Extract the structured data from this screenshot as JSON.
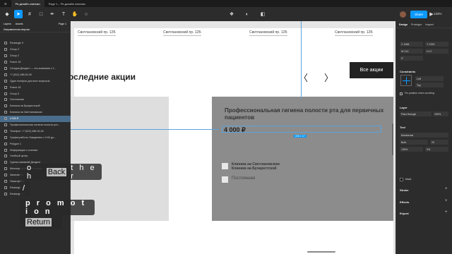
{
  "tabs": [
    {
      "label": "Ре-дизайн клиники",
      "active": true
    },
    {
      "label": "Page 1 – Ре-дизайн клиники",
      "active": false
    }
  ],
  "toolbar": {
    "share_label": "Share",
    "zoom": "133%"
  },
  "left_panel": {
    "tab_layers": "Layers",
    "tab_assets": "Assets",
    "page_selector": "Page 1",
    "current_page": "Исправленная версия",
    "layers": [
      "Rectangle 3",
      "Group 3",
      "Group 2",
      "Frame 15",
      "Сегодня Дендент — это компания с 1...",
      "+7 (812) 488-00-00",
      "Один телефон для всех вопросов",
      "Frame 18",
      "Group 5",
      "Постоянная",
      "Клиника на Бухарестской",
      "Клиника на Светлановском",
      "4 000 ₽",
      "Профессиональная гигиена полости рта...",
      "Телефон: +7 (812) 488-00-00",
      "График работы: Ежедневно с 9:00 до...",
      "Polygon 1",
      "Информация о клинике",
      "Учебный центр",
      "Группа компаний Дендент",
      "Многопрофильная клиника",
      "Записаться",
      "Наши врачи",
      "Rectangle 37",
      "Rectangle 21"
    ],
    "selected_index": 12
  },
  "canvas": {
    "addresses": [
      "Светлановский пр. 12Б",
      "Светлановский пр. 12Б",
      "Светлановский пр. 12Б",
      "Светлановский пр. 12Б"
    ],
    "heading": "оследние акции",
    "arrow_prev": "〈",
    "arrow_next": "〉",
    "all_button": "Все акции",
    "card_title": "Профессиональная гигиена полости рта для первичных пациентов",
    "price": "4 000 ₽",
    "selection_size": "226 × 17",
    "clinics": "Клиника на Светлановском\nКлиника на Бухарестской",
    "permanent": "Постоянная"
  },
  "right_panel": {
    "tabs": [
      "Design",
      "Prototype",
      "Inspect"
    ],
    "x_label": "X",
    "x_value": "1068",
    "y_label": "Y",
    "y_value": "2153",
    "w_label": "W",
    "w_value": "213",
    "h_label": "H",
    "h_value": "17",
    "rotation": "0°",
    "constraints_title": "Constraints",
    "constraint_h": "Left",
    "constraint_v": "Top",
    "fix_position": "Fix position when scrolling",
    "layer_title": "Layer",
    "blend": "Pass through",
    "opacity": "100%",
    "text_title": "Text",
    "font": "Montserrat",
    "weight": "Bold",
    "font_size": "20",
    "line_height": "135%",
    "letter_spacing": "0%",
    "fill_name": "black",
    "stroke_title": "Stroke",
    "effects_title": "Effects",
    "export_title": "Export"
  },
  "overlay": {
    "line1_pre": "o h",
    "line1_hl": "Back",
    "line1_post": "t h e r",
    "line2": "/",
    "line3": "p r o m o t i o n",
    "line4_hl": "Return"
  }
}
